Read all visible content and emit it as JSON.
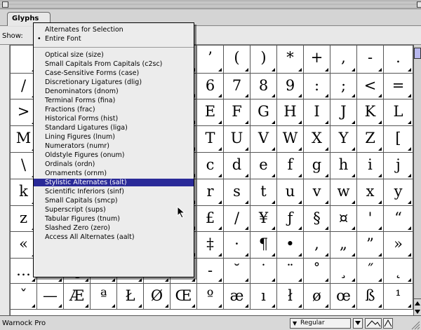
{
  "window": {
    "tab_label": "Glyphs",
    "show_label": "Show:"
  },
  "menu": {
    "items": [
      {
        "label": "Alternates for Selection",
        "checked": false
      },
      {
        "label": "Entire Font",
        "checked": true
      },
      {
        "label": "Optical size (size)"
      },
      {
        "label": "Small Capitals From Capitals (c2sc)"
      },
      {
        "label": "Case-Sensitive Forms (case)"
      },
      {
        "label": "Discretionary Ligatures (dlig)"
      },
      {
        "label": "Denominators (dnom)"
      },
      {
        "label": "Terminal Forms (fina)"
      },
      {
        "label": "Fractions (frac)"
      },
      {
        "label": "Historical Forms (hist)"
      },
      {
        "label": "Standard Ligatures (liga)"
      },
      {
        "label": "Lining Figures (lnum)"
      },
      {
        "label": "Numerators (numr)"
      },
      {
        "label": "Oldstyle Figures (onum)"
      },
      {
        "label": "Ordinals (ordn)"
      },
      {
        "label": "Ornaments (ornm)"
      },
      {
        "label": "Stylistic Alternates (salt)",
        "selected": true
      },
      {
        "label": "Scientific Inferiors (sinf)"
      },
      {
        "label": "Small Capitals (smcp)"
      },
      {
        "label": "Superscript (sups)"
      },
      {
        "label": "Tabular Figures (tnum)"
      },
      {
        "label": "Slashed Zero (zero)"
      },
      {
        "label": "Access All Alternates (aalt)"
      }
    ],
    "check_mark": "•"
  },
  "grid": {
    "rows": [
      [
        "",
        "",
        "",
        "",
        "",
        "",
        "",
        "’",
        "(",
        ")",
        "*",
        "+",
        ",",
        "-",
        "."
      ],
      [
        "/",
        "",
        "",
        "",
        "",
        "",
        "",
        "6",
        "7",
        "8",
        "9",
        ":",
        ";",
        "<",
        "="
      ],
      [
        ">",
        "",
        "",
        "",
        "",
        "",
        "",
        "E",
        "F",
        "G",
        "H",
        "I",
        "J",
        "K",
        "L"
      ],
      [
        "M",
        "",
        "",
        "",
        "",
        "",
        "",
        "T",
        "U",
        "V",
        "W",
        "X",
        "Y",
        "Z",
        "["
      ],
      [
        "\\",
        "",
        "",
        "",
        "",
        "",
        "",
        "c",
        "d",
        "e",
        "f",
        "g",
        "h",
        "i",
        "j"
      ],
      [
        "k",
        "",
        "",
        "",
        "",
        "",
        "",
        "r",
        "s",
        "t",
        "u",
        "v",
        "w",
        "x",
        "y"
      ],
      [
        "z",
        "",
        "",
        "",
        "",
        "",
        "",
        "£",
        "/",
        "¥",
        "ƒ",
        "§",
        "¤",
        "'",
        "“"
      ],
      [
        "«",
        "",
        "",
        "",
        "",
        "",
        "",
        "‡",
        "·",
        "¶",
        "•",
        ",",
        "„",
        "”",
        "»"
      ],
      [
        "…",
        "‰",
        "¿",
        "",
        "",
        "",
        "",
        "-",
        "˘",
        "˙",
        "¨",
        "˚",
        "¸",
        "˝",
        "˛"
      ],
      [
        "ˇ",
        "—",
        "Æ",
        "ª",
        "Ł",
        "Ø",
        "Œ",
        "º",
        "æ",
        "ı",
        "ł",
        "ø",
        "œ",
        "ß",
        "¹"
      ]
    ]
  },
  "status": {
    "font_name": "Warnock Pro",
    "font_style": "Regular",
    "zoom_out_icon": "small-mountain-icon",
    "zoom_in_icon": "large-mountain-icon"
  },
  "colors": {
    "selection": "#2a2a98",
    "scroll_thumb": "#b8b8ee"
  }
}
